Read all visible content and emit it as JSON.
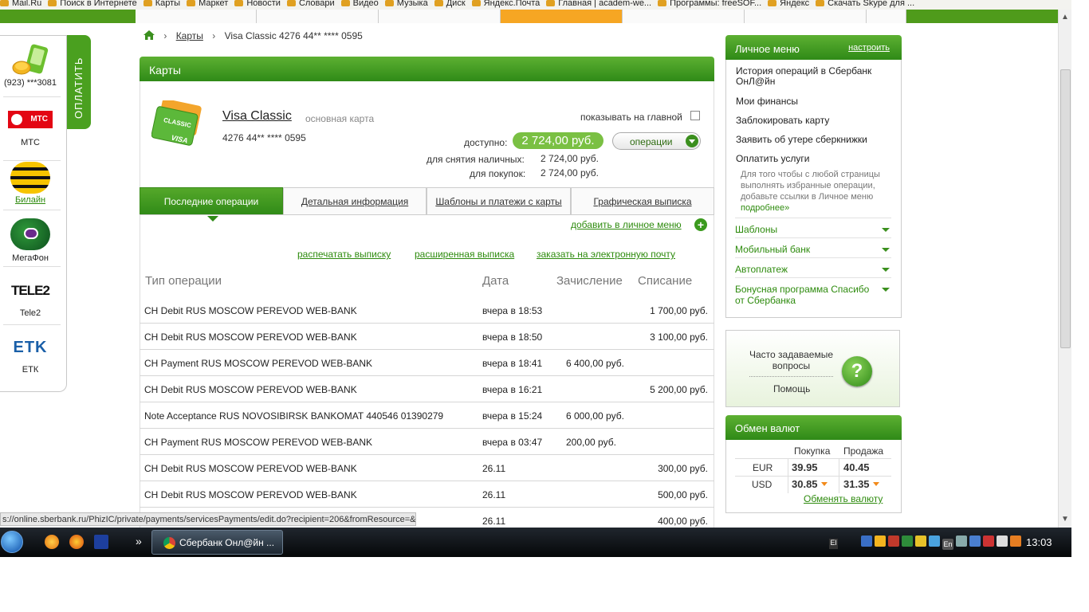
{
  "browser": {
    "bookmarks": [
      "Mail.Ru",
      "Поиск в Интернете",
      "Карты",
      "Маркет",
      "Новости",
      "Словари",
      "Видео",
      "Музыка",
      "Диск",
      "Яндекс.Почта",
      "Главная | academ-we...",
      "Программы: freeSOF...",
      "Яндекс",
      "Скачать Skype для ..."
    ],
    "status_url": "s://online.sberbank.ru/PhizIC/private/payments/servicesPayments/edit.do?recipient=206&fromResource=&"
  },
  "pay_panel": {
    "tab_label": "ОПЛАТИТЬ",
    "operators": [
      {
        "label": "(923) ***3081",
        "icon": "phone-coins-icon"
      },
      {
        "label": "МТС",
        "icon": "mts-logo"
      },
      {
        "label": "Билайн",
        "icon": "beeline-logo"
      },
      {
        "label": "МегаФон",
        "icon": "megafon-logo"
      },
      {
        "label": "Tele2",
        "icon": "tele2-logo",
        "logo_text": "TELE2"
      },
      {
        "label": "ЕТК",
        "icon": "etk-logo",
        "logo_text": "ETK"
      }
    ],
    "mts_logo_text": "МТС"
  },
  "breadcrumb": {
    "link": "Карты",
    "current": "Visa Classic 4276 44** **** 0595"
  },
  "card": {
    "section_title": "Карты",
    "name": "Visa Classic",
    "type": "основная карта",
    "number": "4276 44** **** 0595",
    "image_text_top": "CLASSIC",
    "image_text_brand": "VISA",
    "show_on_main": "показывать на главной",
    "available_label": "доступно:",
    "available_value": "2 724,00 руб.",
    "operations_button": "операции",
    "cash_label": "для снятия наличных:",
    "cash_value": "2 724,00 руб.",
    "purchases_label": "для покупок:",
    "purchases_value": "2 724,00 руб."
  },
  "tabs": [
    "Последние операции",
    "Детальная информация",
    "Шаблоны и платежи с карты",
    "Графическая выписка"
  ],
  "links": {
    "add_to_menu": "добавить в личное меню",
    "print": "распечатать выписку",
    "extended": "расширенная выписка",
    "email": "заказать на электронную почту"
  },
  "table": {
    "headers": [
      "Тип операции",
      "Дата",
      "Зачисление",
      "Списание"
    ],
    "rows": [
      {
        "type": "CH Debit RUS MOSCOW PEREVOD WEB-BANK",
        "date": "вчера в 18:53",
        "credit": "",
        "debit": "1 700,00 руб."
      },
      {
        "type": "CH Debit RUS MOSCOW PEREVOD WEB-BANK",
        "date": "вчера в 18:50",
        "credit": "",
        "debit": "3 100,00 руб."
      },
      {
        "type": "CH Payment RUS MOSCOW PEREVOD WEB-BANK",
        "date": "вчера в 18:41",
        "credit": "6 400,00 руб.",
        "debit": ""
      },
      {
        "type": "CH Debit RUS MOSCOW PEREVOD WEB-BANK",
        "date": "вчера в 16:21",
        "credit": "",
        "debit": "5 200,00 руб."
      },
      {
        "type": "Note Acceptance RUS NOVOSIBIRSK BANKOMAT 440546 01390279",
        "date": "вчера в 15:24",
        "credit": "6 000,00 руб.",
        "debit": ""
      },
      {
        "type": "CH Payment RUS MOSCOW PEREVOD WEB-BANK",
        "date": "вчера в 03:47",
        "credit": "200,00 руб.",
        "debit": ""
      },
      {
        "type": "CH Debit RUS MOSCOW PEREVOD WEB-BANK",
        "date": "26.11",
        "credit": "",
        "debit": "300,00 руб."
      },
      {
        "type": "CH Debit RUS MOSCOW PEREVOD WEB-BANK",
        "date": "26.11",
        "credit": "",
        "debit": "500,00 руб."
      },
      {
        "type": "",
        "date": "26.11",
        "credit": "",
        "debit": "400,00 руб."
      }
    ]
  },
  "personal_menu": {
    "title": "Личное меню",
    "configure": "настроить",
    "items": [
      "История операций в Сбербанк ОнЛ@йн",
      "Мои финансы",
      "Заблокировать карту",
      "Заявить об утере сберкнижки",
      "Оплатить услуги"
    ],
    "hint": "Для того чтобы с любой страницы выполнять избранные операции, добавьте ссылки в Личное меню",
    "hint_more": "подробнее»",
    "sections": [
      "Шаблоны",
      "Мобильный банк",
      "Автоплатеж",
      "Бонусная программа Спасибо от Сбербанка"
    ]
  },
  "faq": {
    "title": "Часто задаваемые вопросы",
    "help": "Помощь",
    "icon_glyph": "?"
  },
  "currency": {
    "title": "Обмен валют",
    "buy_header": "Покупка",
    "sell_header": "Продажа",
    "rates": [
      {
        "code": "EUR",
        "buy": "39.95",
        "sell": "40.45",
        "buy_down": false,
        "sell_down": false
      },
      {
        "code": "USD",
        "buy": "30.85",
        "sell": "31.35",
        "buy_down": true,
        "sell_down": true
      }
    ],
    "exchange_link": "Обменять валюту"
  },
  "taskbar": {
    "task": "Сбербанк Онл@йн ...",
    "lang": "El",
    "tray_lang": "En",
    "time": "13:03",
    "more_glyph": "»"
  }
}
